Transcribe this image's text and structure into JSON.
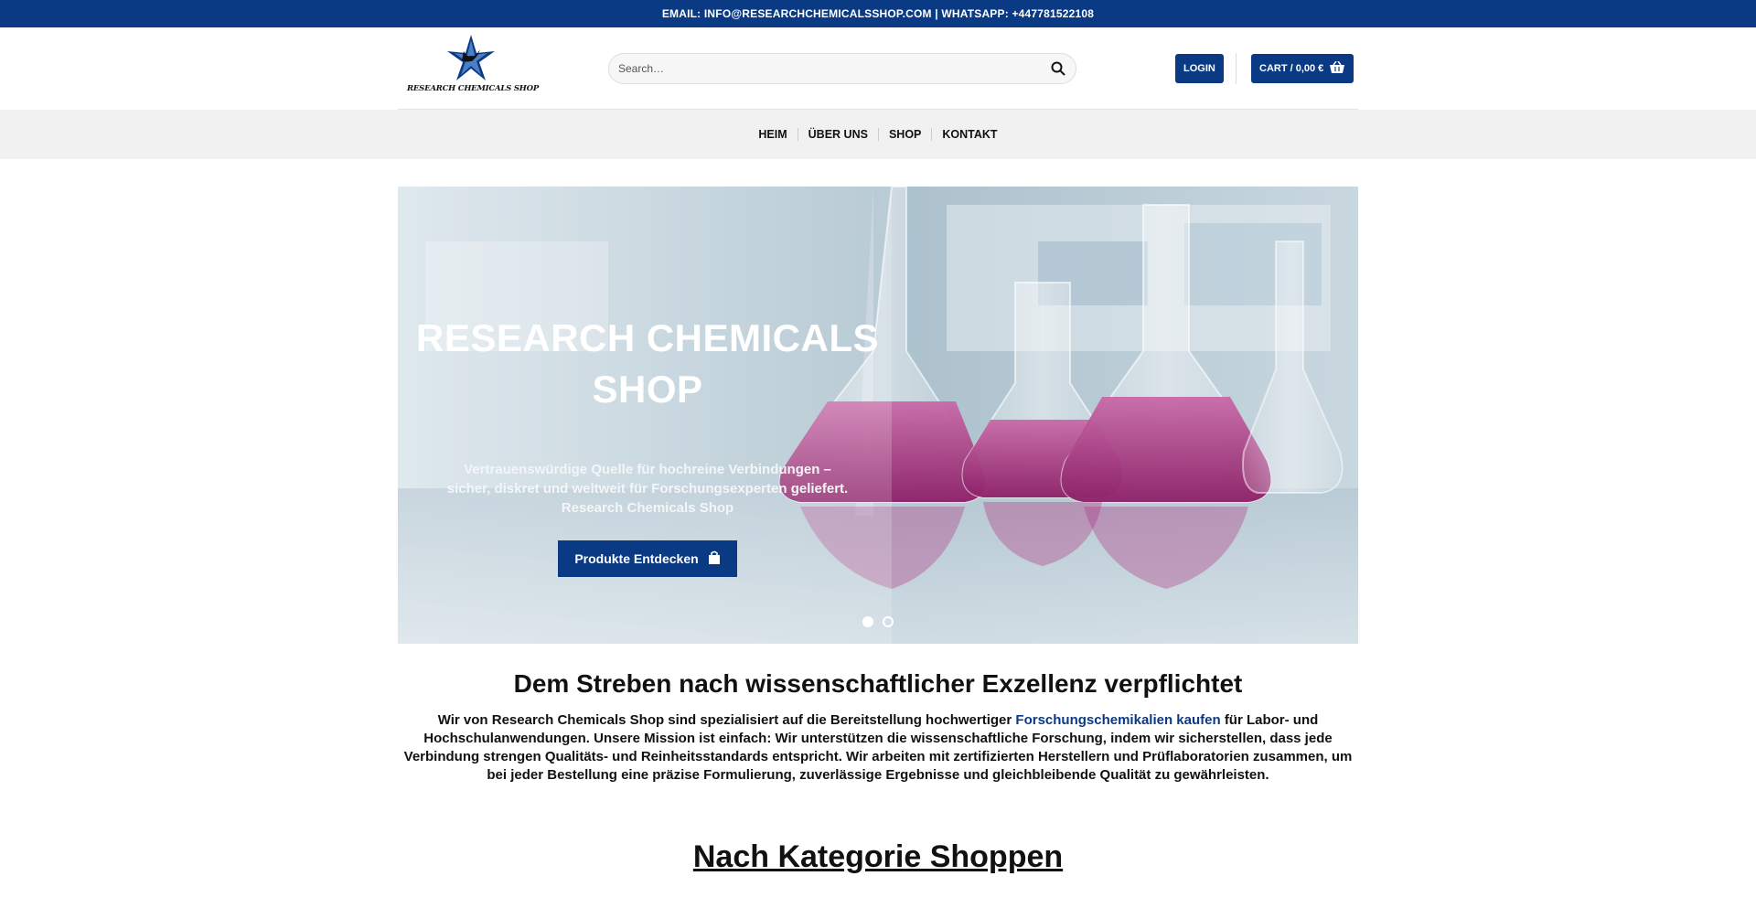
{
  "topbar": {
    "text": "EMAIL: INFO@RESEARCHCHEMICALSSHOP.COM | WHATSAPP: +447781522108"
  },
  "header": {
    "logo_text": "RESEARCH CHEMICALS SHOP",
    "search_placeholder": "Search…",
    "login_label": "LOGIN",
    "cart_label": "CART / 0,00 €"
  },
  "nav": {
    "items": [
      {
        "label": "HEIM"
      },
      {
        "label": "ÜBER UNS"
      },
      {
        "label": "SHOP"
      },
      {
        "label": "KONTAKT"
      }
    ]
  },
  "hero": {
    "title_line1": "RESEARCH CHEMICALS",
    "title_line2": "SHOP",
    "text": "Vertrauenswürdige Quelle für hochreine Verbindungen – sicher, diskret und weltweit für Forschungsexperten geliefert. Research Chemicals Shop",
    "button_label": "Produkte Entdecken",
    "slide_count": 2,
    "active_slide": 1
  },
  "section": {
    "heading": "Dem Streben nach wissenschaftlicher Exzellenz verpflichtet",
    "text_before": "Wir von Research Chemicals Shop sind spezialisiert auf die Bereitstellung hochwertiger ",
    "link": "Forschungschemikalien kaufen",
    "text_after": " für Labor- und Hochschulanwendungen. Unsere Mission ist einfach: Wir unterstützen die wissenschaftliche Forschung, indem wir sicherstellen, dass jede Verbindung strengen Qualitäts- und Reinheitsstandards entspricht. Wir arbeiten mit zertifizierten Herstellern und Prüflaboratorien zusammen, um bei jeder Bestellung eine präzise Formulierung, zuverlässige Ergebnisse und gleichbleibende Qualität zu gewährleisten."
  },
  "category": {
    "heading": "Nach Kategorie Shoppen"
  },
  "colors": {
    "primary": "#0a3a84",
    "nav_bg": "#f1f1f1",
    "liquid": "#b0307f"
  }
}
